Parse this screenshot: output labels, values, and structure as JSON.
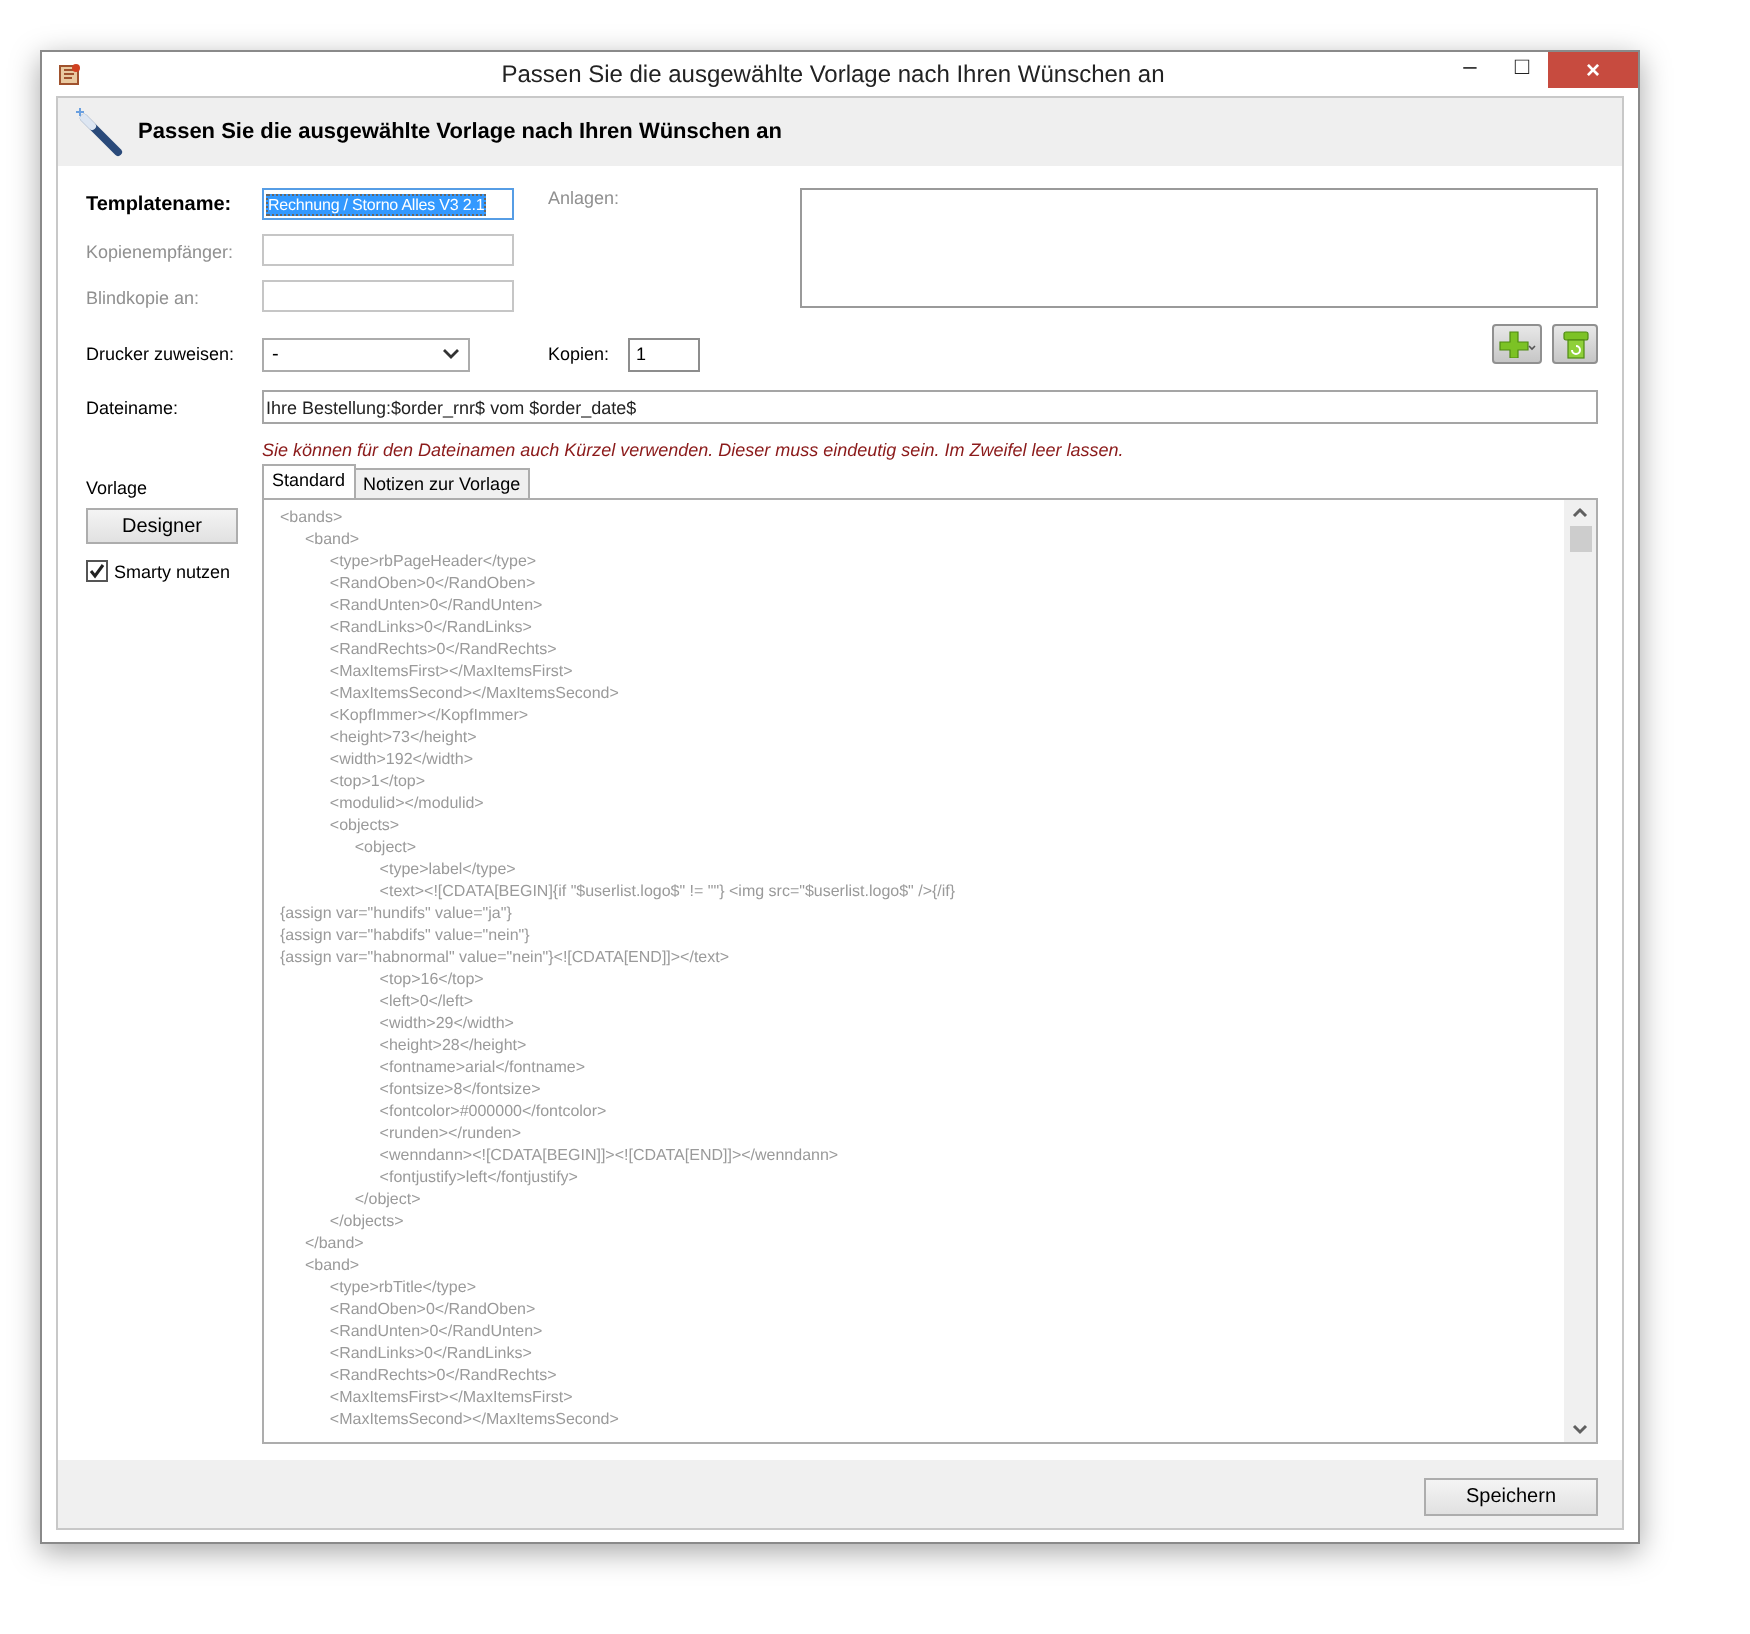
{
  "window": {
    "title": "Passen Sie die ausgewählte Vorlage nach Ihren Wünschen an",
    "controls": [
      "–",
      "□",
      "×"
    ]
  },
  "header": {
    "title": "Passen Sie die ausgewählte Vorlage nach Ihren Wünschen an"
  },
  "fields": [
    {
      "label": "Templatename:",
      "value": "Rechnung / Storno Alles V3 2.1",
      "selected": true,
      "disabled": false
    },
    {
      "label": "Kopienempfänger:",
      "selected": false,
      "disabled": true
    },
    {
      "label": "Blindkopie an:",
      "selected": false,
      "disabled": true
    }
  ],
  "attachments": {
    "label": "Anlagen:"
  },
  "printer": {
    "label": "Drucker zuweisen:",
    "value": "-"
  },
  "copies": {
    "label": "Kopien:",
    "value": "1"
  },
  "filename": {
    "label": "Dateiname:",
    "value": "Ihre Bestellung:$order_rnr$ vom $order_date$",
    "hint": "Sie können für den Dateinamen auch Kürzel verwenden. Dieser muss eindeutig sein. Im Zweifel leer lassen."
  },
  "template": {
    "label": "Vorlage",
    "designer_button": "Designer",
    "smarty": {
      "label": "Smarty nutzen",
      "checked": true
    }
  },
  "tabs": [
    {
      "label": "Standard",
      "selected": true
    },
    {
      "label": "Notizen zur Vorlage",
      "selected": false
    }
  ],
  "editor_lines": [
    "<bands>",
    "\t<band>",
    "\t\t<type>rbPageHeader</type>",
    "\t\t<RandOben>0</RandOben>",
    "\t\t<RandUnten>0</RandUnten>",
    "\t\t<RandLinks>0</RandLinks>",
    "\t\t<RandRechts>0</RandRechts>",
    "\t\t<MaxItemsFirst></MaxItemsFirst>",
    "\t\t<MaxItemsSecond></MaxItemsSecond>",
    "\t\t<KopfImmer></KopfImmer>",
    "\t\t<height>73</height>",
    "\t\t<width>192</width>",
    "\t\t<top>1</top>",
    "\t\t<modulid></modulid>",
    "\t\t<objects>",
    "\t\t\t<object>",
    "\t\t\t\t<type>label</type>",
    "\t\t\t\t<text><![CDATA[BEGIN]{if \"$userlist.logo$\" != \"\"} <img src=\"$userlist.logo$\" />{/if}",
    "{assign var=\"hundifs\" value=\"ja\"}",
    "{assign var=\"habdifs\" value=\"nein\"}",
    "{assign var=\"habnormal\" value=\"nein\"}<![CDATA[END]]></text>",
    "\t\t\t\t<top>16</top>",
    "\t\t\t\t<left>0</left>",
    "\t\t\t\t<width>29</width>",
    "\t\t\t\t<height>28</height>",
    "\t\t\t\t<fontname>arial</fontname>",
    "\t\t\t\t<fontsize>8</fontsize>",
    "\t\t\t\t<fontcolor>#000000</fontcolor>",
    "\t\t\t\t<runden></runden>",
    "\t\t\t\t<wenndann><![CDATA[BEGIN]]><![CDATA[END]]></wenndann>",
    "\t\t\t\t<fontjustify>left</fontjustify>",
    "\t\t\t</object>",
    "\t\t</objects>",
    "\t</band>",
    "\t<band>",
    "\t\t<type>rbTitle</type>",
    "\t\t<RandOben>0</RandOben>",
    "\t\t<RandUnten>0</RandUnten>",
    "\t\t<RandLinks>0</RandLinks>",
    "\t\t<RandRechts>0</RandRechts>",
    "\t\t<MaxItemsFirst></MaxItemsFirst>",
    "\t\t<MaxItemsSecond></MaxItemsSecond>"
  ],
  "save_button": "Speichern"
}
